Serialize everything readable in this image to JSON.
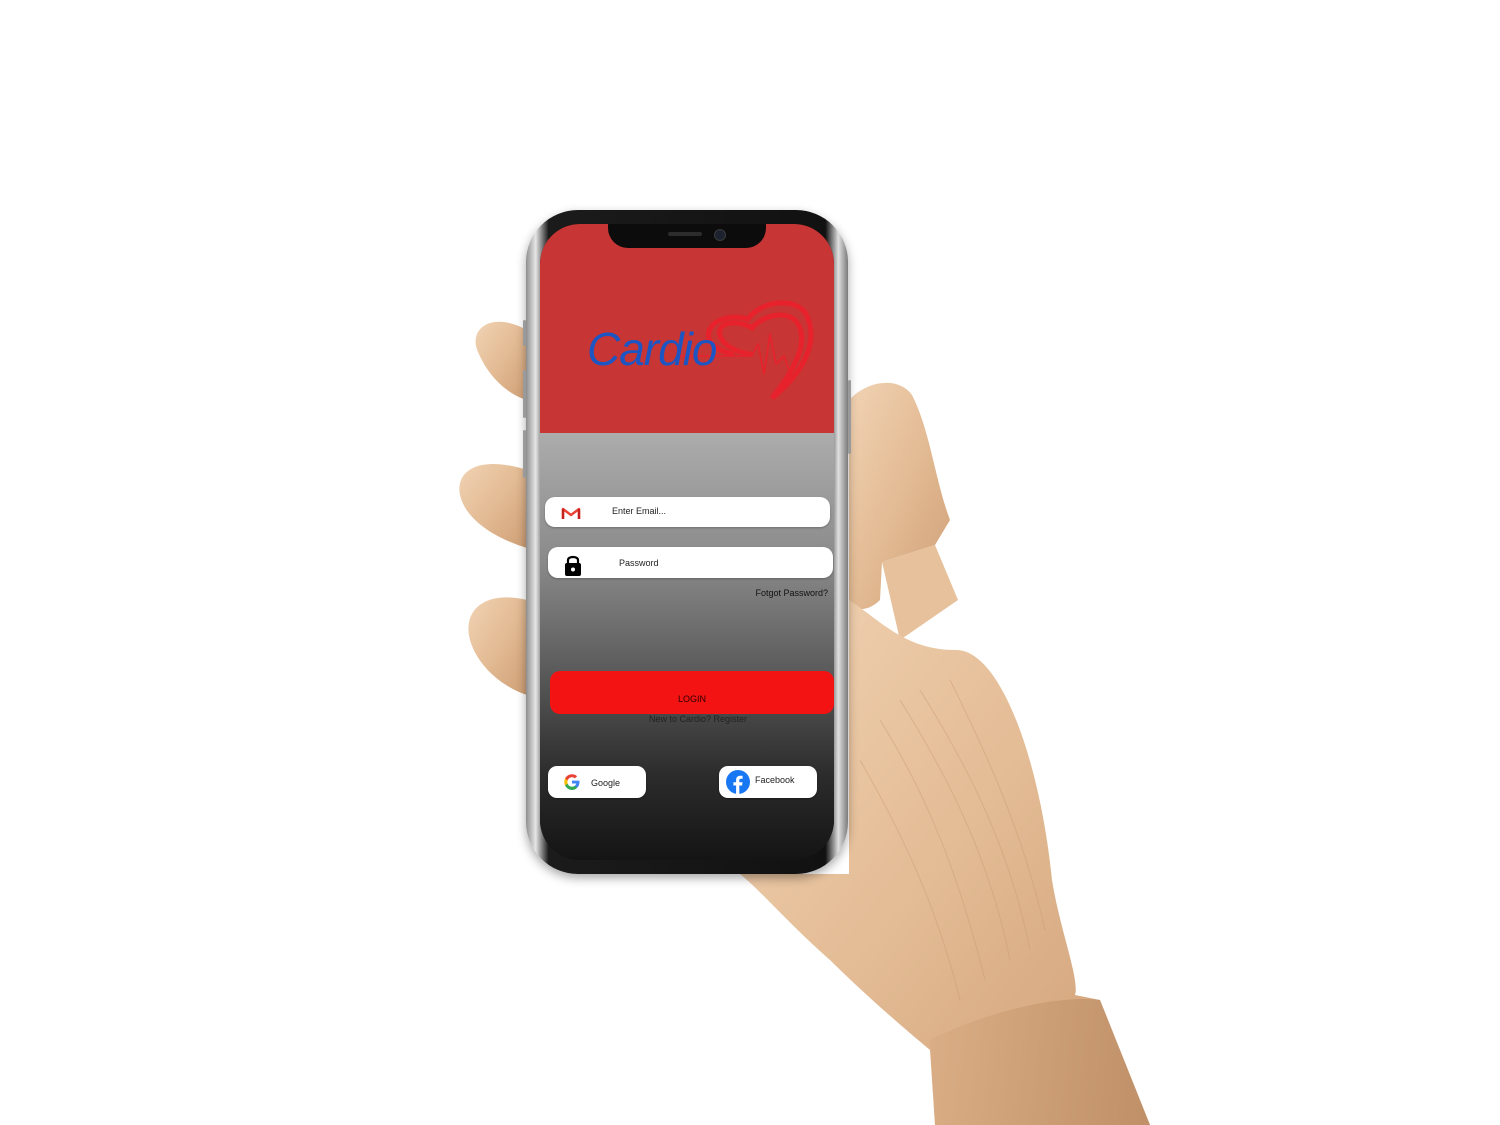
{
  "app": {
    "name": "Cardio"
  },
  "login": {
    "email_placeholder": "Enter Email...",
    "password_placeholder": "Password",
    "forgot_password": "Fotgot Password?",
    "login_button": "LOGIN",
    "register_link": "New to Cardio? Register"
  },
  "social": {
    "google_label": "Google",
    "facebook_label": "Facebook"
  },
  "colors": {
    "header": "#c73534",
    "login_button": "#f31313",
    "logo_text": "#1d56c3",
    "logo_heart": "#e8222c",
    "facebook": "#1877f2"
  },
  "icons": {
    "email": "gmail-icon",
    "password": "lock-icon",
    "google": "google-icon",
    "facebook": "facebook-icon",
    "logo": "heart-pulse-icon"
  }
}
